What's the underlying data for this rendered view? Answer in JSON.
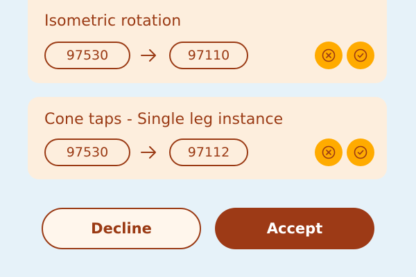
{
  "cards": [
    {
      "title": "Isometric rotation",
      "from_code": "97530",
      "to_code": "97110",
      "arrow_icon": "arrow-right-icon",
      "reject_icon": "x-circle-icon",
      "confirm_icon": "check-circle-icon"
    },
    {
      "title": "Cone taps - Single leg instance",
      "from_code": "97530",
      "to_code": "97112",
      "arrow_icon": "arrow-right-icon",
      "reject_icon": "x-circle-icon",
      "confirm_icon": "check-circle-icon"
    }
  ],
  "actions": {
    "decline_label": "Decline",
    "accept_label": "Accept"
  },
  "colors": {
    "background": "#e6f2f9",
    "card": "#fdeedd",
    "brand": "#9a3a14",
    "icon_button": "#ffab00"
  }
}
